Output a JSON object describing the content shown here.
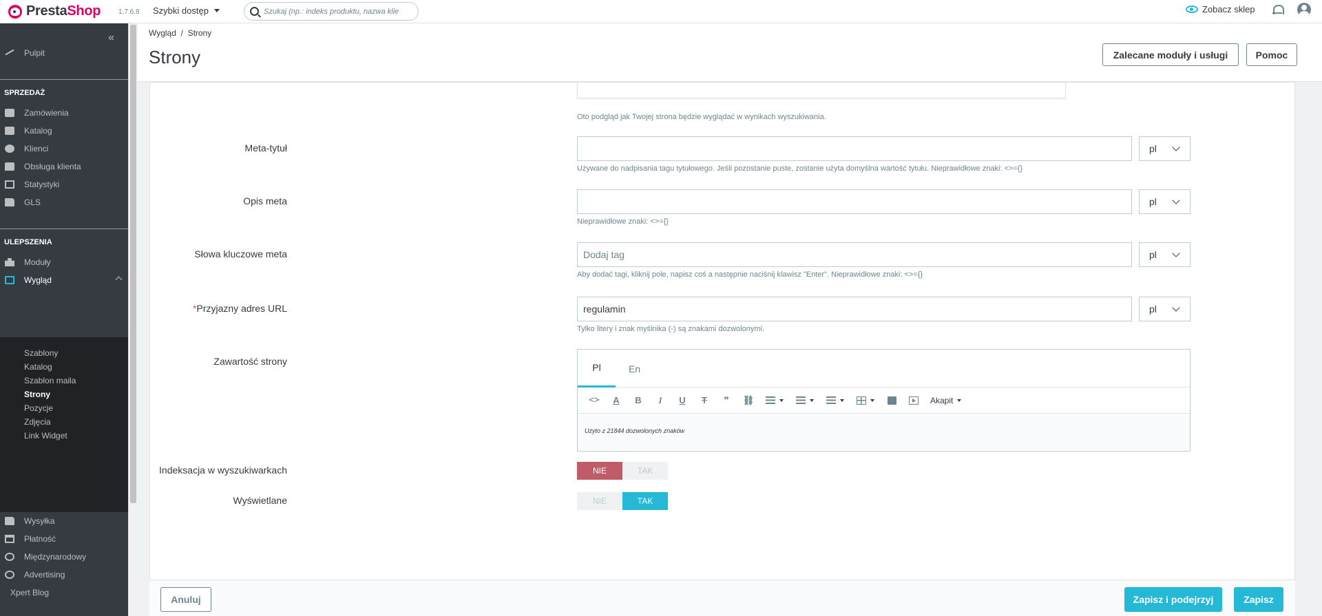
{
  "header": {
    "logo_presta": "Presta",
    "logo_shop": "Shop",
    "version": "1.7.6.8",
    "quick_access": "Szybki dostęp",
    "search_placeholder": "Szukaj (np.: indeks produktu, nazwa klie",
    "view_shop": "Zobacz sklep"
  },
  "sidebar": {
    "collapse_glyph": "«",
    "dashboard": "Pulpit",
    "sales_title": "SPRZEDAŻ",
    "sales": [
      "Zamówienia",
      "Katalog",
      "Klienci",
      "Obsługa klienta",
      "Statystyki",
      "GLS"
    ],
    "improvements_title": "ULEPSZENIA",
    "modules": "Moduły",
    "appearance": "Wygląd",
    "appearance_sub": [
      "Szablony",
      "Katalog",
      "Szablon maila",
      "Strony",
      "Pozycje",
      "Zdjęcia",
      "Link Widget"
    ],
    "rest": [
      "Wysyłka",
      "Płatność",
      "Międzynarodowy",
      "Advertising"
    ],
    "xpert_blog": "Xpert Blog"
  },
  "page": {
    "breadcrumb": "Wygląd  /  Strony",
    "title": "Strony",
    "btn_modules": "Zalecane moduły i usługi",
    "btn_help": "Pomoc"
  },
  "form": {
    "preview_help": "Oto podgląd jak Twojej strona będzie wyglądać w wynikach wyszukiwania.",
    "meta_title_label": "Meta-tytuł",
    "meta_title_help": "Używane do nadpisania tagu tytułowego. Jeśli pozostanie puste, zostanie użyta domyślna wartość tytułu. Nieprawidłowe znaki: <>={}",
    "meta_desc_label": "Opis meta",
    "meta_desc_help": "Nieprawidłowe znaki: <>={}",
    "meta_keywords_label": "Słowa kluczowe meta",
    "meta_keywords_placeholder": "Dodaj tag",
    "meta_keywords_help": "Aby dodać tagi, kliknij pole, napisz coś a następnie naciśnij klawisz \"Enter\". Nieprawidłowe znaki: <>={}",
    "url_required_mark": "*",
    "url_label": "Przyjazny adres URL",
    "url_value": "regulamin",
    "url_help": "Tylko litery i znak myślnika (-) są znakami dozwolonymi.",
    "lang": "pl",
    "content_label": "Zawartość strony",
    "tabs": [
      "Pl",
      "En"
    ],
    "paragraph": "Akapit",
    "char_counter": "Użyto z 21844 dozwolonych znaków",
    "indexing_label": "Indeksacja w wyszukiwarkach",
    "displayed_label": "Wyświetlane",
    "no": "NIE",
    "yes": "TAK"
  },
  "footer": {
    "cancel": "Anuluj",
    "save_preview": "Zapisz i podejrzyj",
    "save": "Zapisz"
  },
  "colors": {
    "accent": "#25b9d7",
    "danger": "#c05c67",
    "sidebar_bg": "#363a41",
    "brand": "#df0067"
  }
}
